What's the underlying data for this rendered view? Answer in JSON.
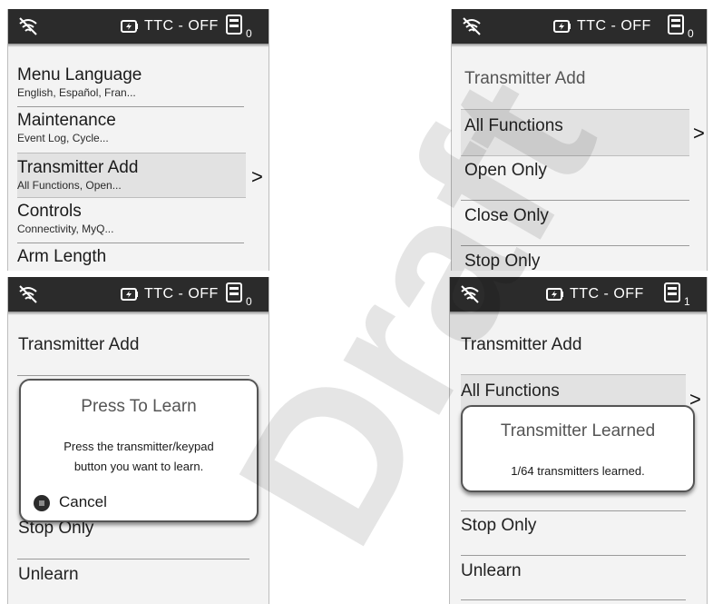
{
  "status": {
    "ttc": "TTC - OFF"
  },
  "panel1": {
    "count": "0",
    "items": [
      {
        "title": "Menu Language",
        "sub": "English, Español, Fran..."
      },
      {
        "title": "Maintenance",
        "sub": "Event Log, Cycle..."
      },
      {
        "title": "Transmitter Add",
        "sub": "All Functions, Open..."
      },
      {
        "title": "Controls",
        "sub": "Connectivity, MyQ..."
      },
      {
        "title": "Arm Length",
        "sub": ""
      }
    ],
    "chevron": ">"
  },
  "panel2": {
    "count": "0",
    "title": "Transmitter Add",
    "items": [
      "All Functions",
      "Open Only",
      "Close Only",
      "Stop Only"
    ],
    "chevron": ">"
  },
  "panel3": {
    "count": "0",
    "title": "Transmitter Add",
    "items": [
      "Stop Only",
      "Unlearn"
    ],
    "dialog": {
      "title": "Press To Learn",
      "line1": "Press the transmitter/keypad",
      "line2": "button you want to learn.",
      "cancel": "Cancel"
    }
  },
  "panel4": {
    "count": "1",
    "title": "Transmitter Add",
    "items": [
      "All Functions",
      "Stop Only",
      "Unlearn"
    ],
    "chevron": ">",
    "dialog": {
      "title": "Transmitter Learned",
      "body": "1/64 transmitters learned."
    }
  },
  "watermark": "Draft"
}
